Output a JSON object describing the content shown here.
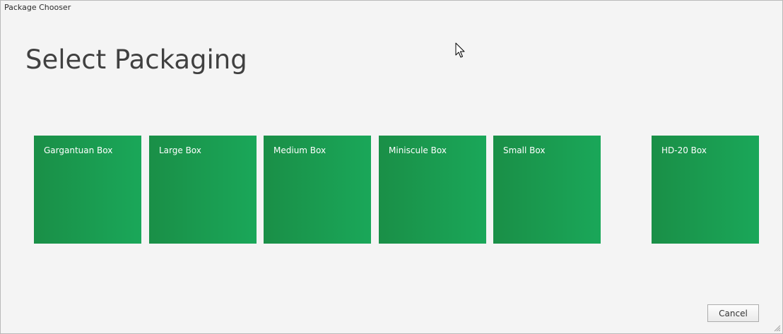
{
  "window": {
    "title": "Package Chooser"
  },
  "main": {
    "heading": "Select Packaging",
    "tile_color_start": "#1a8f47",
    "tile_color_end": "#1aa759",
    "packages": [
      {
        "label": "Gargantuan Box"
      },
      {
        "label": "Large Box"
      },
      {
        "label": "Medium Box"
      },
      {
        "label": "Miniscule Box"
      },
      {
        "label": "Small Box"
      },
      {
        "label": "HD-20 Box"
      }
    ]
  },
  "footer": {
    "cancel_label": "Cancel"
  },
  "icons": {
    "cursor": "mouse-cursor-icon",
    "grip": "resize-grip-icon"
  }
}
